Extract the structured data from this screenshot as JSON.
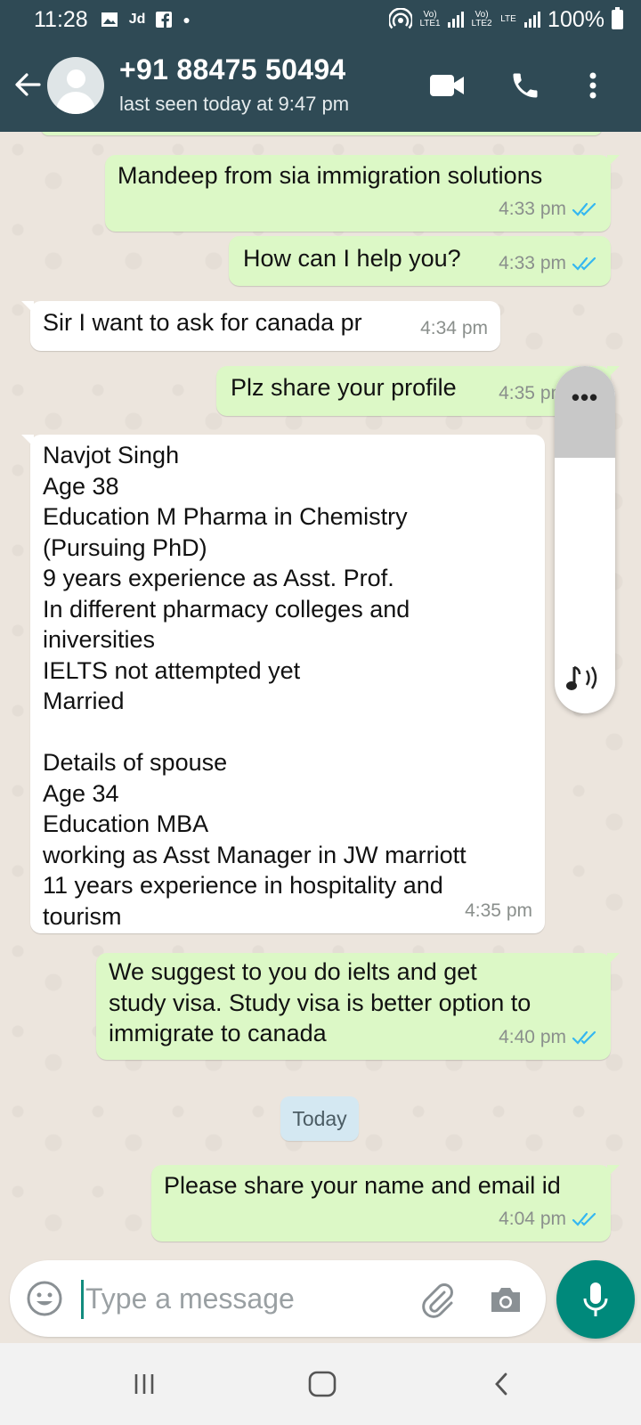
{
  "status_bar": {
    "time": "11:28",
    "left_icons": [
      "gallery-icon",
      "jd-icon",
      "facebook-icon",
      "dot-icon"
    ],
    "jd_label": "Jd",
    "sim1_label": "Vo) LTE1",
    "sim2_label": "Vo) LTE2",
    "lte_label": "LTE",
    "battery": "100%"
  },
  "header": {
    "contact_name": "+91 88475 50494",
    "last_seen": "last seen today at 9:47 pm"
  },
  "messages": [
    {
      "direction": "out",
      "text": "Mandeep from sia immigration solutions",
      "time": "4:33 pm",
      "read": true
    },
    {
      "direction": "out",
      "text": "How can I help you?",
      "time": "4:33 pm",
      "read": true
    },
    {
      "direction": "in",
      "text": "Sir I want to ask for canada pr",
      "time": "4:34 pm"
    },
    {
      "direction": "out",
      "text": "Plz share your profile",
      "time": "4:35 pm",
      "read": true
    },
    {
      "direction": "in",
      "text": "Navjot Singh\nAge 38\nEducation M Pharma in Chemistry\n(Pursuing PhD)\n9 years experience as Asst. Prof.\nIn different pharmacy colleges and\niniversities\nIELTS not attempted yet\nMarried\n\nDetails of spouse\nAge 34\nEducation MBA\nworking as Asst Manager in JW marriott\n11 years experience in hospitality and\ntourism",
      "time": "4:35 pm"
    },
    {
      "direction": "out",
      "text": "We suggest to you do ielts and get\nstudy visa. Study visa is better option to\nimmigrate to canada",
      "time": "4:40 pm",
      "read": true
    },
    {
      "direction": "out",
      "text": "Please share your name and email id",
      "time": "4:04 pm",
      "read": true
    }
  ],
  "day_separator": "Today",
  "scroll_popup": {
    "menu_label": "•••"
  },
  "composer": {
    "placeholder": "Type a message"
  },
  "colors": {
    "header": "#2f4a55",
    "outgoing_bubble": "#dcf8c6",
    "incoming_bubble": "#ffffff",
    "chat_background": "#ece5dd",
    "accent": "#00897b",
    "read_ticks": "#34b7f1"
  }
}
